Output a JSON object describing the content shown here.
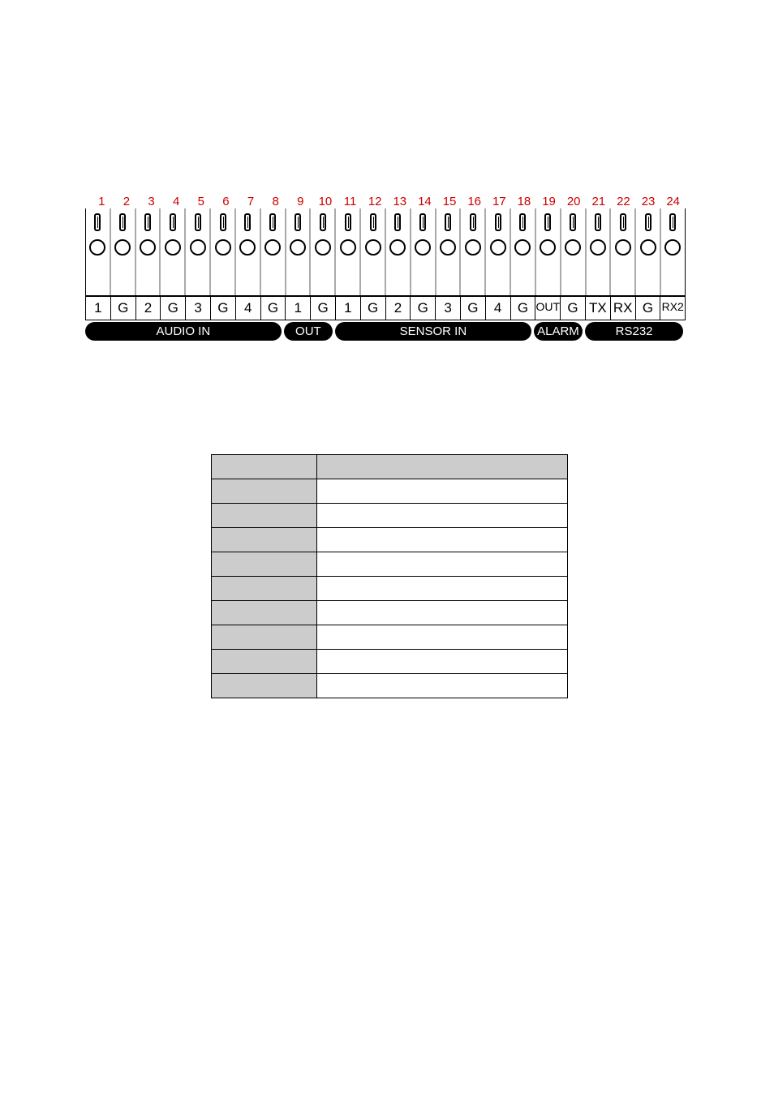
{
  "terminal_numbers": [
    "1",
    "2",
    "3",
    "4",
    "5",
    "6",
    "7",
    "8",
    "9",
    "10",
    "11",
    "12",
    "13",
    "14",
    "15",
    "16",
    "17",
    "18",
    "19",
    "20",
    "21",
    "22",
    "23",
    "24"
  ],
  "pin_labels": [
    "1",
    "G",
    "2",
    "G",
    "3",
    "G",
    "4",
    "G",
    "1",
    "G",
    "1",
    "G",
    "2",
    "G",
    "3",
    "G",
    "4",
    "G",
    "OUT",
    "G",
    "TX",
    "RX",
    "G",
    "RX2"
  ],
  "sections": [
    {
      "label": "AUDIO IN",
      "span": 8
    },
    {
      "label": "OUT",
      "span": 2
    },
    {
      "label": "SENSOR IN",
      "span": 8
    },
    {
      "label": "ALARM",
      "span": 2
    },
    {
      "label": "RS232",
      "span": 4
    }
  ],
  "table": {
    "header": [
      "",
      ""
    ],
    "rows": [
      [
        "",
        ""
      ],
      [
        "",
        ""
      ],
      [
        "",
        ""
      ],
      [
        "",
        ""
      ],
      [
        "",
        ""
      ],
      [
        "",
        ""
      ],
      [
        "",
        ""
      ],
      [
        "",
        ""
      ],
      [
        "",
        ""
      ],
      [
        "",
        ""
      ]
    ]
  }
}
